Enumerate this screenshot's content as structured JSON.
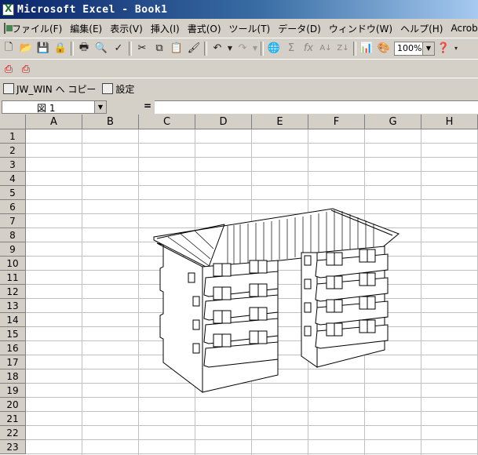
{
  "titlebar": {
    "title": "Microsoft Excel - Book1"
  },
  "menu": [
    "ファイル(F)",
    "編集(E)",
    "表示(V)",
    "挿入(I)",
    "書式(O)",
    "ツール(T)",
    "データ(D)",
    "ウィンドウ(W)",
    "ヘルプ(H)",
    "Acrobat(B)"
  ],
  "toolbar": {
    "zoom": "100%",
    "jw_copy_label": "JW_WIN へ コピー",
    "settings_label": "設定"
  },
  "formula": {
    "name_box": "図 1",
    "equals": "=",
    "value": ""
  },
  "sheet": {
    "columns": [
      "A",
      "B",
      "C",
      "D",
      "E",
      "F",
      "G",
      "H"
    ],
    "rows": [
      "1",
      "2",
      "3",
      "4",
      "5",
      "6",
      "7",
      "8",
      "9",
      "10",
      "11",
      "12",
      "13",
      "14",
      "15",
      "16",
      "17",
      "18",
      "19",
      "20",
      "21",
      "22",
      "23"
    ]
  },
  "drawing": {
    "name": "図 1",
    "subject": "4-story apartment building line drawing"
  }
}
